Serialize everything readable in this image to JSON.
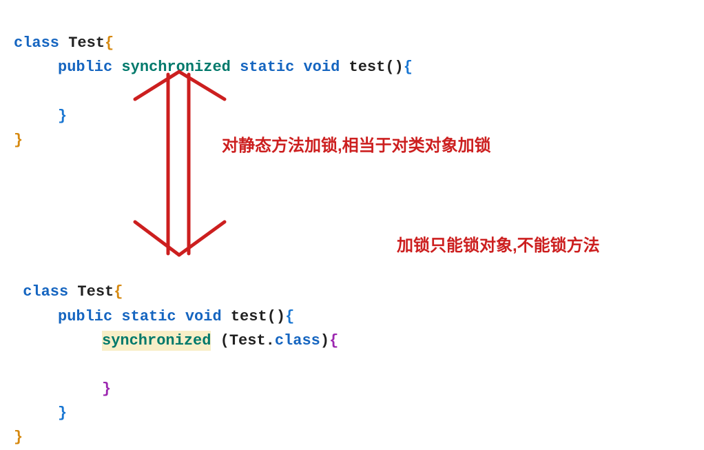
{
  "code1": {
    "kw_class": "class",
    "name": "Test",
    "kw_public": "public",
    "kw_sync": "synchronized",
    "kw_static": "static",
    "kw_void": "void",
    "method": "test",
    "parens": "()"
  },
  "code2": {
    "kw_class": "class",
    "name": "Test",
    "kw_public": "public",
    "kw_static": "static",
    "kw_void": "void",
    "method": "test",
    "parens": "()",
    "kw_sync": "synchronized",
    "sync_arg_prefix": "(Test.",
    "sync_arg_kw": "class",
    "sync_arg_suffix": ")"
  },
  "annotations": {
    "a1": "对静态方法加锁,相当于对类对象加锁",
    "a2": "加锁只能锁对象,不能锁方法"
  }
}
